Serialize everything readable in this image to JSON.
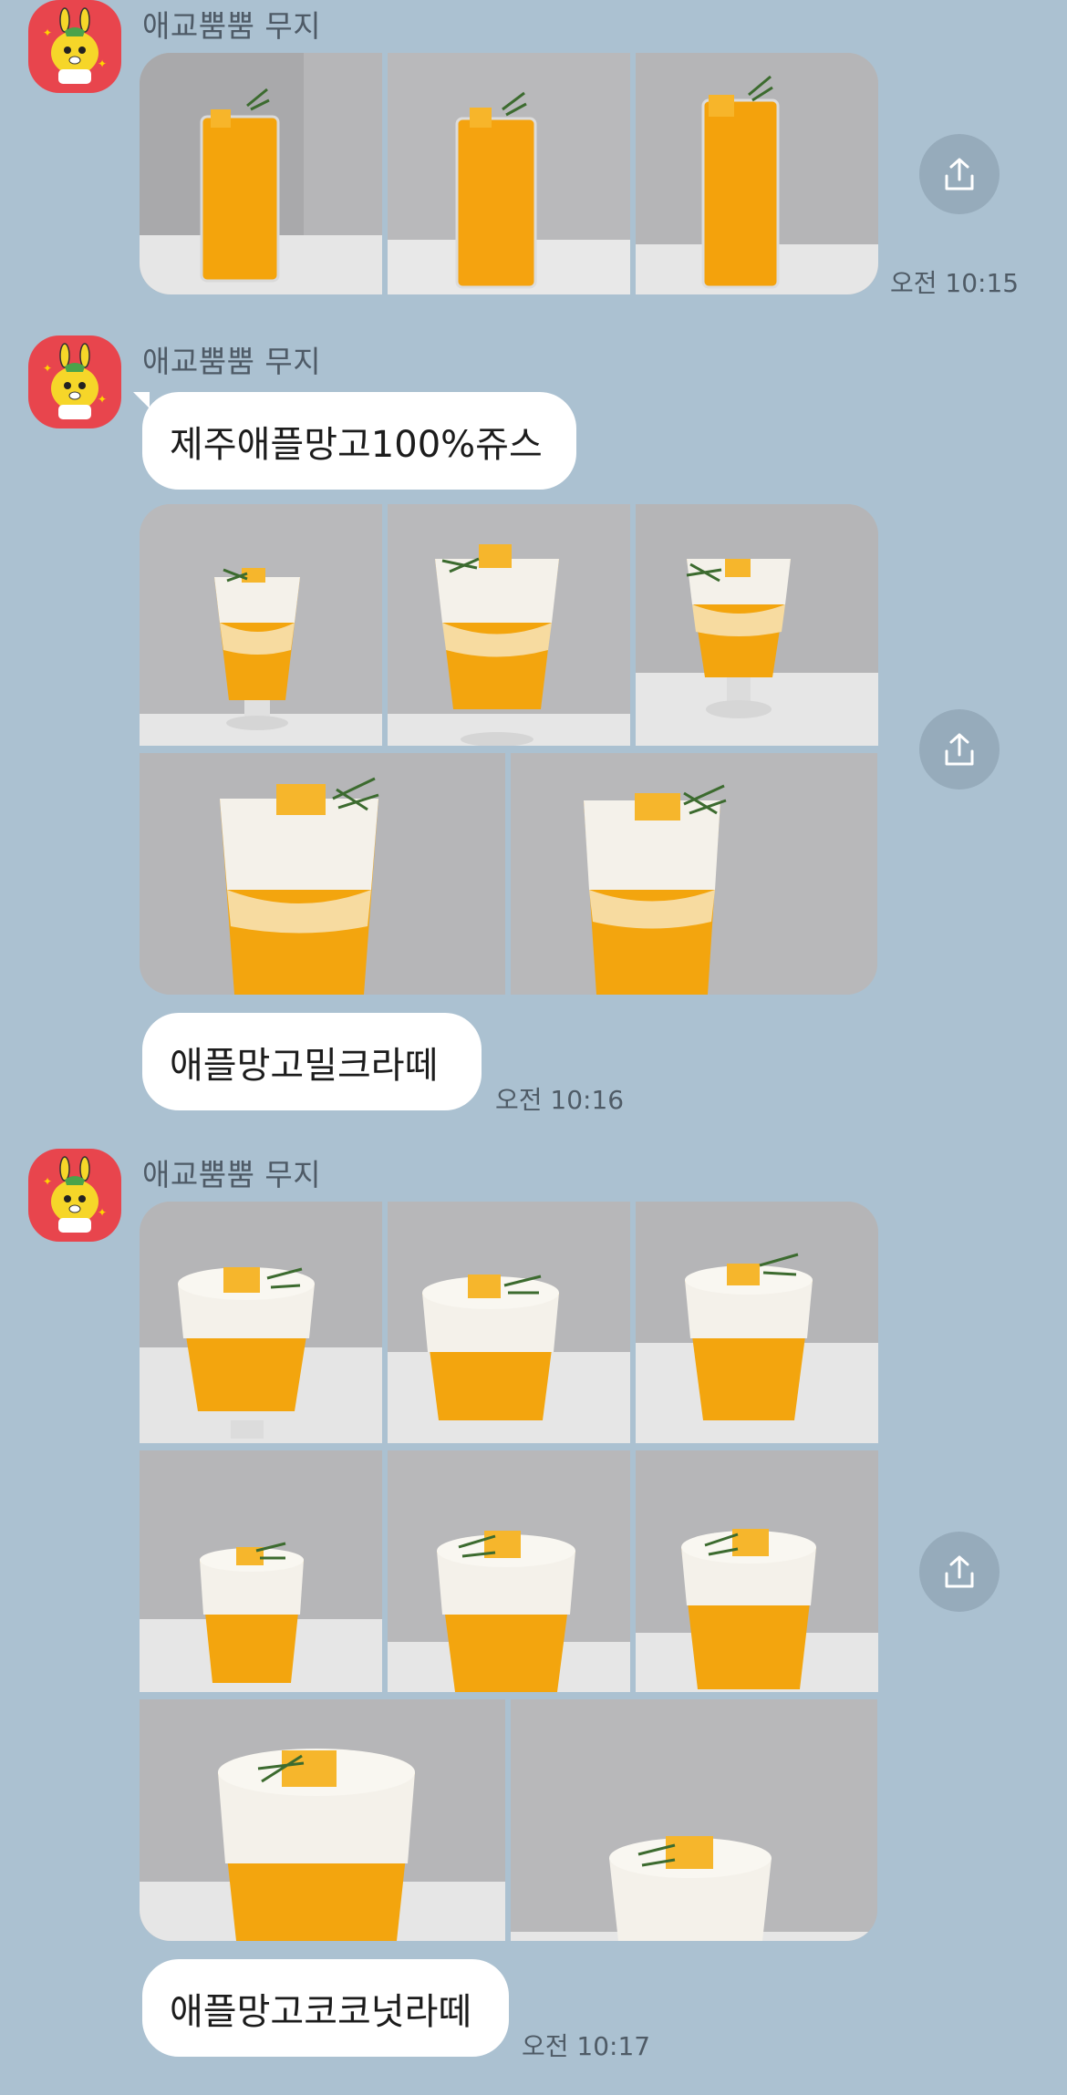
{
  "colors": {
    "chat_background": "#abc1d1",
    "bubble": "#ffffff",
    "avatar_bg": "#e8454d",
    "share_button": "#96abbb",
    "mango": "#f3a50e",
    "cream": "#f4f1ea"
  },
  "messages": [
    {
      "sender": "애교뿜뿜 무지",
      "type": "photo-album",
      "photo_count": 3,
      "time": "오전 10:15",
      "drink": "juice"
    },
    {
      "sender": "애교뿜뿜 무지",
      "type": "text",
      "text": "제주애플망고100%쥬스"
    },
    {
      "type": "photo-album",
      "photo_count": 5,
      "drink": "milk-latte"
    },
    {
      "type": "text",
      "text": "애플망고밀크라떼",
      "time": "오전 10:16"
    },
    {
      "sender": "애교뿜뿜 무지",
      "type": "photo-album",
      "photo_count": 8,
      "drink": "coconut-latte"
    },
    {
      "type": "text",
      "text": "애플망고코코넛라떼",
      "time": "오전 10:17"
    }
  ],
  "icons": {
    "share": "share-icon",
    "avatar": "muzi-avatar-icon"
  }
}
